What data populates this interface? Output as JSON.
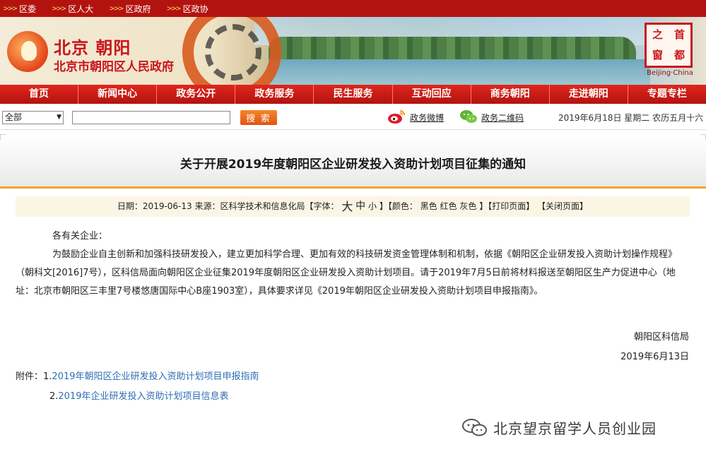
{
  "topbar": {
    "links": [
      {
        "label": "区委"
      },
      {
        "label": "区人大"
      },
      {
        "label": "区政府"
      },
      {
        "label": "区政协"
      }
    ],
    "chev": ">>>"
  },
  "banner": {
    "site_name": "北京 朝阳",
    "site_sub": "北京市朝阳区人民政府",
    "seal_chars": [
      "之",
      "首",
      "窗",
      "都"
    ],
    "seal_caption": "Beijing·China"
  },
  "nav": {
    "items": [
      "首页",
      "新闻中心",
      "政务公开",
      "政务服务",
      "民生服务",
      "互动回应",
      "商务朝阳",
      "走进朝阳",
      "专题专栏"
    ]
  },
  "toolbar": {
    "select_value": "全部",
    "search_value": "",
    "search_button": "搜 索",
    "weibo_label": "政务微博",
    "wechat_label": "政务二维码",
    "date": "2019年6月18日 星期二 农历五月十六"
  },
  "article": {
    "title": "关于开展2019年度朝阳区企业研发投入资助计划项目征集的通知",
    "meta": {
      "date_prefix": "日期：2019-06-13 来源：区科学技术和信息化局【字体：",
      "size_large": "大",
      "size_medium": "中",
      "size_small": "小",
      "color_prefix": "】【颜色：",
      "color_black": "黑色",
      "color_red": "红色",
      "color_gray": "灰色",
      "print": "】【打印页面】",
      "close": "【关闭页面】"
    },
    "greeting": "各有关企业：",
    "paragraph": "为鼓励企业自主创新和加强科技研发投入，建立更加科学合理、更加有效的科技研发资金管理体制和机制，依据《朝阳区企业研发投入资助计划操作规程》（朝科文[2016]7号），区科信局面向朝阳区企业征集2019年度朝阳区企业研发投入资助计划项目。请于2019年7月5日前将材料报送至朝阳区生产力促进中心（地址：北京市朝阳区三丰里7号楼悠唐国际中心B座1903室），具体要求详见《2019年朝阳区企业研发投入资助计划项目申报指南》。",
    "signature_org": "朝阳区科信局",
    "signature_date": "2019年6月13日",
    "attachments_label": "附件：",
    "attachments": [
      {
        "num": "1.",
        "title": "2019年朝阳区企业研发投入资助计划项目申报指南"
      },
      {
        "num": "2.",
        "title": "2019年企业研发投入资助计划项目信息表"
      }
    ]
  },
  "watermark": {
    "text": "北京望京留学人员创业园"
  }
}
